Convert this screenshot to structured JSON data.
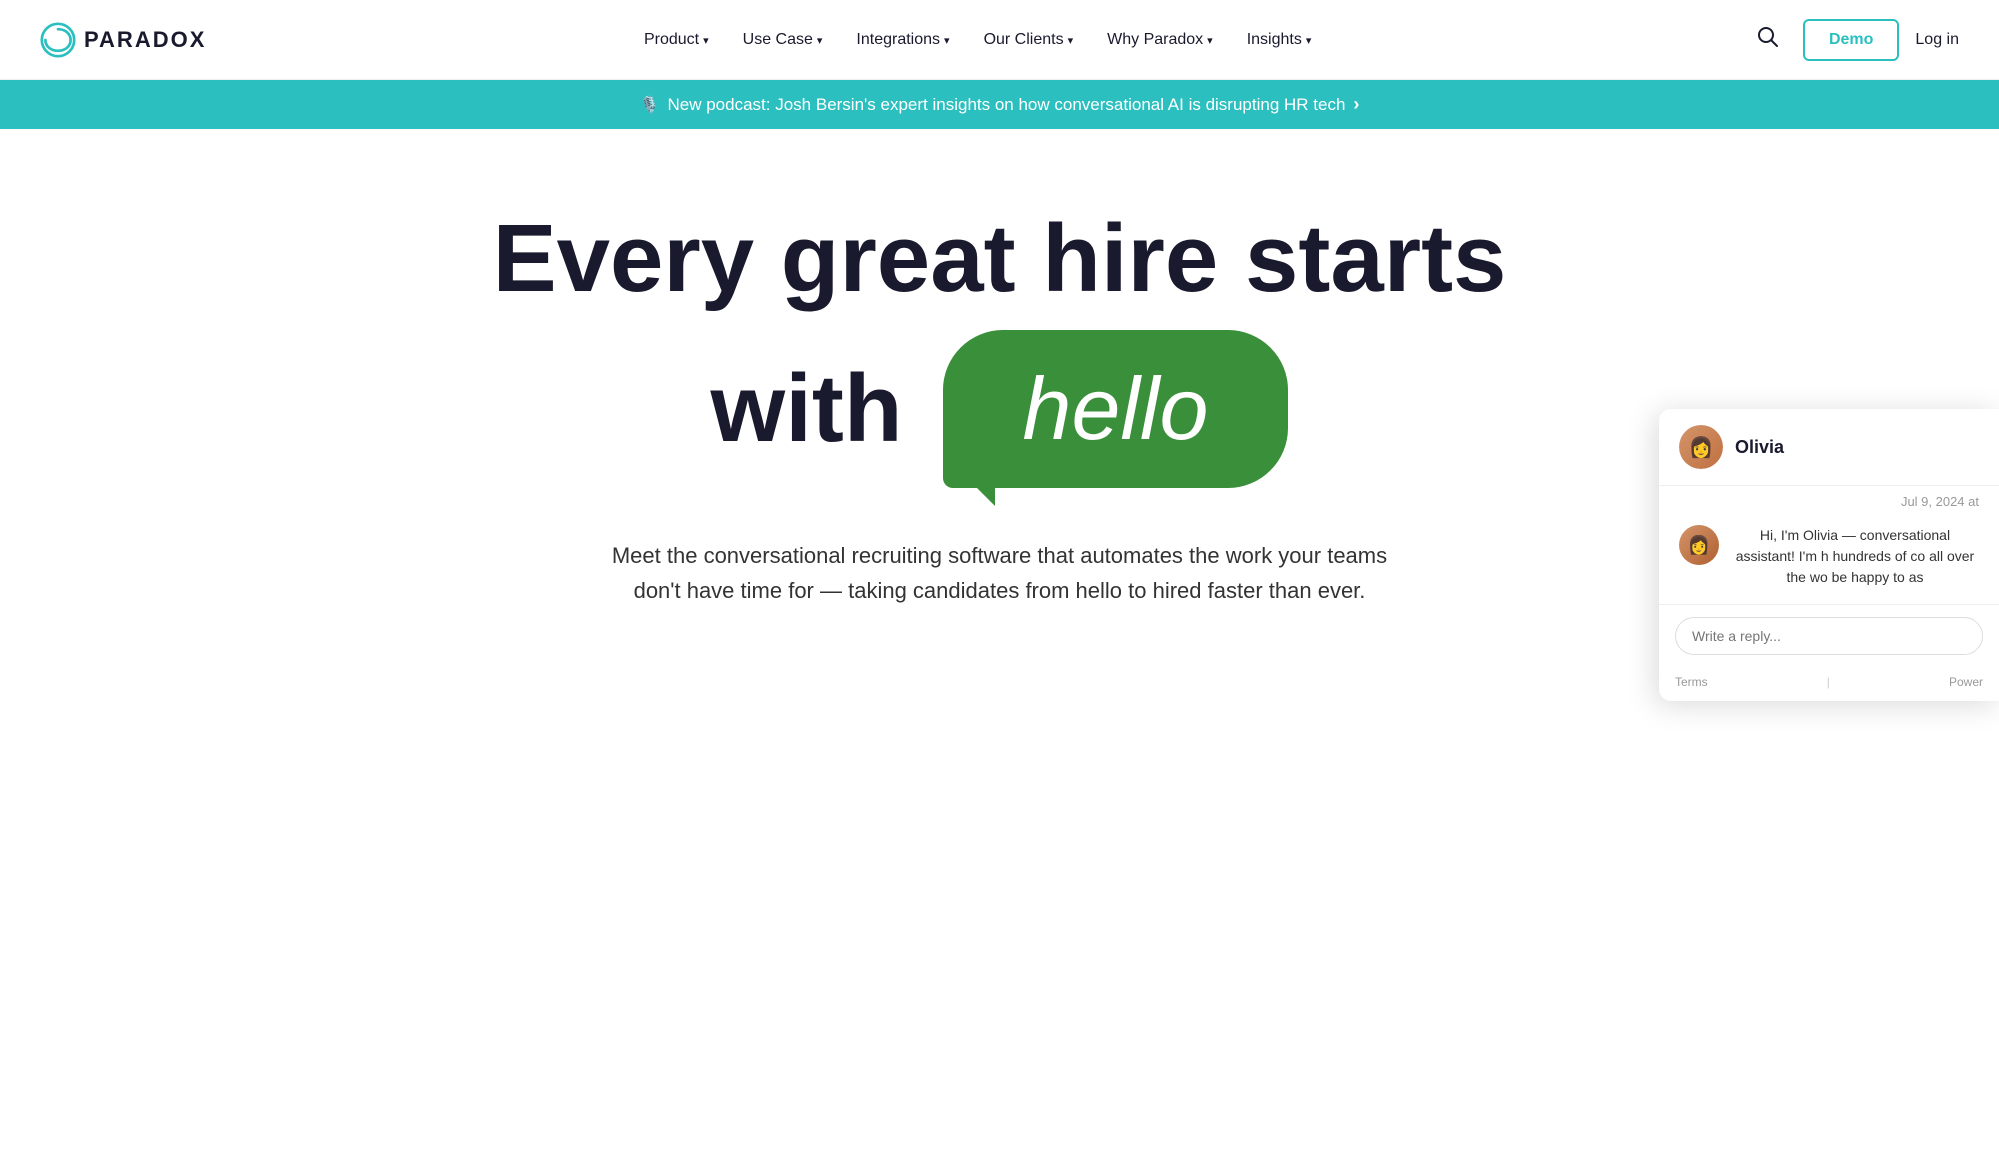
{
  "nav": {
    "logo_text": "PARADOX",
    "items": [
      {
        "label": "Product",
        "has_dropdown": true
      },
      {
        "label": "Use Case",
        "has_dropdown": true
      },
      {
        "label": "Integrations",
        "has_dropdown": true
      },
      {
        "label": "Our Clients",
        "has_dropdown": true
      },
      {
        "label": "Why Paradox",
        "has_dropdown": true
      },
      {
        "label": "Insights",
        "has_dropdown": true
      }
    ],
    "search_label": "🔍",
    "demo_label": "Demo",
    "login_label": "Log in"
  },
  "banner": {
    "icon": "🎙️",
    "text": "New podcast: Josh Bersin's expert insights on how conversational AI is disrupting HR tech",
    "arrow": "›"
  },
  "hero": {
    "title_line1": "Every great hire starts",
    "title_with_label": "with",
    "hello_text": "hello",
    "subtitle": "Meet the conversational recruiting software that automates the work your teams don't have time for — taking candidates from hello to hired faster than ever."
  },
  "chat_widget": {
    "name": "Olivia",
    "timestamp": "Jul 9, 2024 at",
    "message": "Hi, I'm Olivia — conversational assistant! I'm h hundreds of co all over the wo be happy to as",
    "input_placeholder": "Write a reply...",
    "footer_terms": "Terms",
    "footer_sep": "|",
    "footer_powered": "Power"
  },
  "colors": {
    "teal": "#2bbfbf",
    "dark": "#1a1a2e",
    "green_bubble": "#3a8f3a"
  }
}
